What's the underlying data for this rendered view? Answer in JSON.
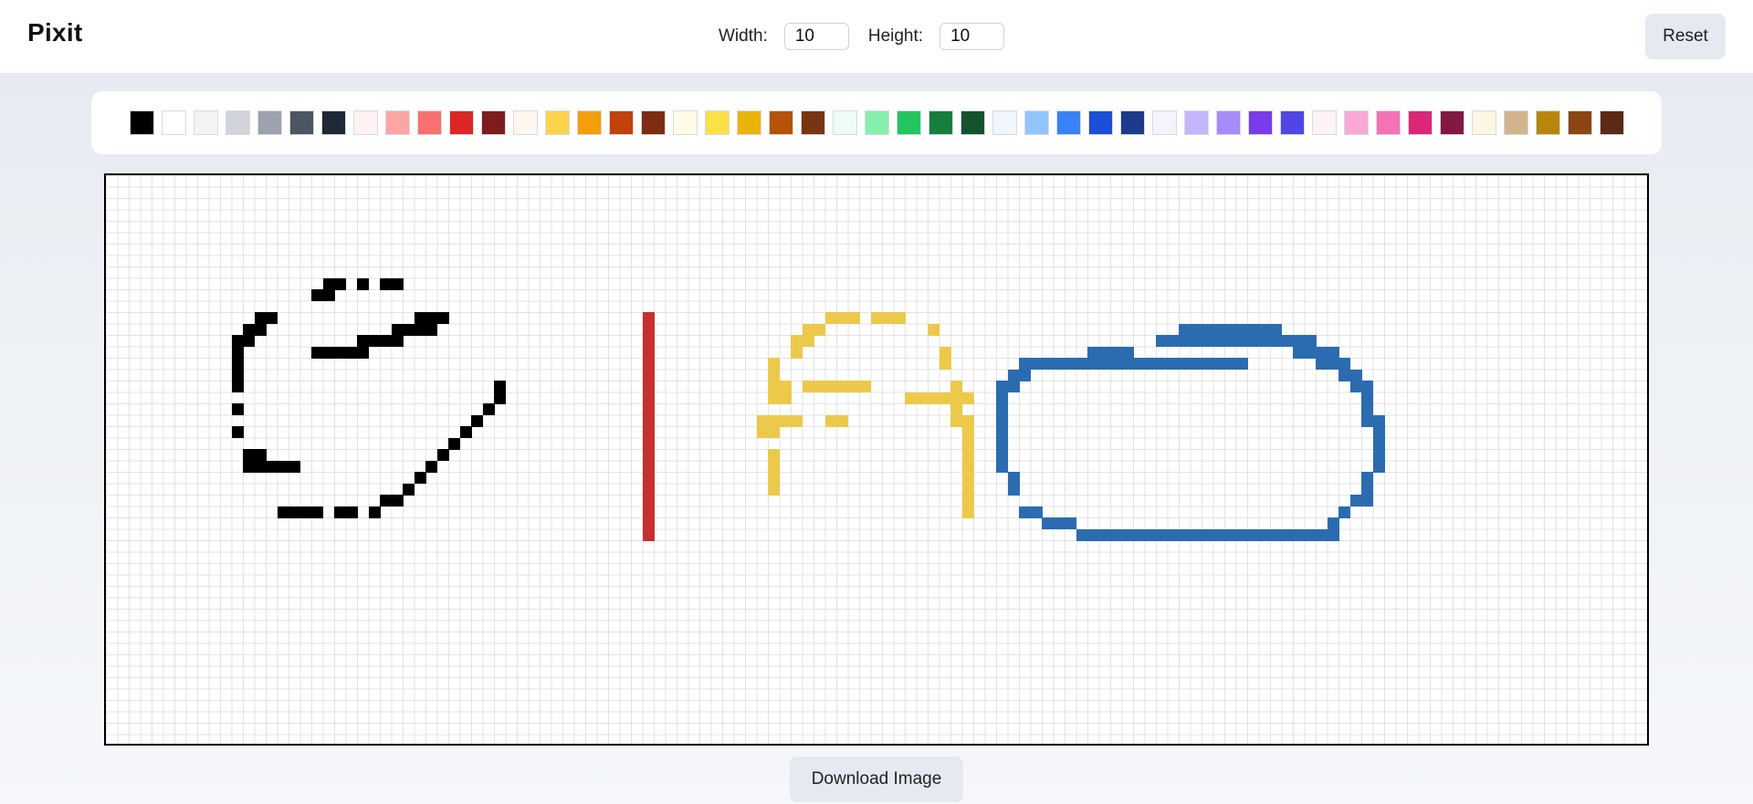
{
  "header": {
    "title": "Pixit",
    "width_label": "Width:",
    "width_value": "10",
    "height_label": "Height:",
    "height_value": "10",
    "reset_label": "Reset"
  },
  "palette": {
    "colors": [
      "#000000",
      "#ffffff",
      "#f3f4f6",
      "#d1d5db",
      "#9ca3af",
      "#4b5563",
      "#1f2937",
      "#fef2f2",
      "#fca5a5",
      "#f87171",
      "#dc2626",
      "#7f1d1d",
      "#fff7ed",
      "#fcd34d",
      "#f59e0b",
      "#c2410c",
      "#7c2d12",
      "#fefce8",
      "#fde047",
      "#eab308",
      "#b45309",
      "#78350f",
      "#ecfdf5",
      "#86efac",
      "#22c55e",
      "#15803d",
      "#14532d",
      "#eff6ff",
      "#93c5fd",
      "#3b82f6",
      "#1d4ed8",
      "#1e3a8a",
      "#f5f3ff",
      "#c4b5fd",
      "#a78bfa",
      "#7c3aed",
      "#4f46e5",
      "#fdf2f8",
      "#f9a8d4",
      "#f472b6",
      "#db2777",
      "#831843",
      "#fdf6e3",
      "#d2b48c",
      "#b8860b",
      "#8b4513",
      "#5c2a14"
    ]
  },
  "canvas": {
    "cell_colors": {
      "black": "#000000",
      "red": "#c53030",
      "yellow": "#ecc94b",
      "blue": "#2b6cb0"
    },
    "strokes": [
      {
        "color": "black",
        "cells": [
          [
            19,
            9
          ],
          [
            20,
            9
          ],
          [
            22,
            9
          ],
          [
            24,
            9
          ],
          [
            25,
            9
          ],
          [
            18,
            10
          ],
          [
            19,
            10
          ],
          [
            13,
            12
          ],
          [
            14,
            12
          ],
          [
            27,
            12
          ],
          [
            28,
            12
          ],
          [
            29,
            12
          ],
          [
            12,
            13
          ],
          [
            13,
            13
          ],
          [
            25,
            13
          ],
          [
            26,
            13
          ],
          [
            27,
            13
          ],
          [
            28,
            13
          ],
          [
            11,
            14
          ],
          [
            12,
            14
          ],
          [
            22,
            14
          ],
          [
            23,
            14
          ],
          [
            24,
            14
          ],
          [
            25,
            14
          ],
          [
            11,
            15
          ],
          [
            18,
            15
          ],
          [
            19,
            15
          ],
          [
            20,
            15
          ],
          [
            21,
            15
          ],
          [
            22,
            15
          ],
          [
            11,
            16
          ],
          [
            11,
            17
          ],
          [
            11,
            18
          ],
          [
            34,
            18
          ],
          [
            34,
            19
          ],
          [
            11,
            20
          ],
          [
            33,
            20
          ],
          [
            32,
            21
          ],
          [
            11,
            22
          ],
          [
            31,
            22
          ],
          [
            30,
            23
          ],
          [
            12,
            24
          ],
          [
            13,
            24
          ],
          [
            29,
            24
          ],
          [
            12,
            25
          ],
          [
            13,
            25
          ],
          [
            14,
            25
          ],
          [
            15,
            25
          ],
          [
            16,
            25
          ],
          [
            28,
            25
          ],
          [
            27,
            26
          ],
          [
            26,
            27
          ],
          [
            24,
            28
          ],
          [
            25,
            28
          ],
          [
            23,
            29
          ],
          [
            21,
            29
          ],
          [
            20,
            29
          ],
          [
            17,
            29
          ],
          [
            18,
            29
          ],
          [
            15,
            29
          ],
          [
            16,
            29
          ]
        ]
      },
      {
        "color": "red",
        "cells": [
          [
            47,
            12
          ],
          [
            47,
            13
          ],
          [
            47,
            14
          ],
          [
            47,
            15
          ],
          [
            47,
            16
          ],
          [
            47,
            17
          ],
          [
            47,
            18
          ],
          [
            47,
            19
          ],
          [
            47,
            20
          ],
          [
            47,
            21
          ],
          [
            47,
            22
          ],
          [
            47,
            23
          ],
          [
            47,
            24
          ],
          [
            47,
            25
          ],
          [
            47,
            26
          ],
          [
            47,
            27
          ],
          [
            47,
            28
          ],
          [
            47,
            29
          ],
          [
            47,
            30
          ],
          [
            47,
            31
          ]
        ]
      },
      {
        "color": "yellow",
        "cells": [
          [
            63,
            12
          ],
          [
            64,
            12
          ],
          [
            65,
            12
          ],
          [
            67,
            12
          ],
          [
            68,
            12
          ],
          [
            69,
            12
          ],
          [
            61,
            13
          ],
          [
            62,
            13
          ],
          [
            72,
            13
          ],
          [
            60,
            14
          ],
          [
            61,
            14
          ],
          [
            60,
            15
          ],
          [
            73,
            15
          ],
          [
            58,
            16
          ],
          [
            73,
            16
          ],
          [
            58,
            17
          ],
          [
            58,
            18
          ],
          [
            59,
            18
          ],
          [
            61,
            18
          ],
          [
            62,
            18
          ],
          [
            63,
            18
          ],
          [
            64,
            18
          ],
          [
            65,
            18
          ],
          [
            66,
            18
          ],
          [
            74,
            18
          ],
          [
            58,
            19
          ],
          [
            59,
            19
          ],
          [
            70,
            19
          ],
          [
            71,
            19
          ],
          [
            72,
            19
          ],
          [
            73,
            19
          ],
          [
            74,
            19
          ],
          [
            75,
            19
          ],
          [
            74,
            20
          ],
          [
            57,
            21
          ],
          [
            58,
            21
          ],
          [
            59,
            21
          ],
          [
            60,
            21
          ],
          [
            63,
            21
          ],
          [
            64,
            21
          ],
          [
            74,
            21
          ],
          [
            75,
            21
          ],
          [
            57,
            22
          ],
          [
            58,
            22
          ],
          [
            75,
            22
          ],
          [
            58,
            24
          ],
          [
            58,
            25
          ],
          [
            58,
            26
          ],
          [
            58,
            27
          ],
          [
            75,
            23
          ],
          [
            75,
            24
          ],
          [
            75,
            25
          ],
          [
            75,
            26
          ],
          [
            75,
            27
          ],
          [
            75,
            28
          ],
          [
            75,
            29
          ]
        ]
      },
      {
        "color": "blue",
        "cells": [
          [
            94,
            13
          ],
          [
            95,
            13
          ],
          [
            96,
            13
          ],
          [
            97,
            13
          ],
          [
            98,
            13
          ],
          [
            99,
            13
          ],
          [
            100,
            13
          ],
          [
            101,
            13
          ],
          [
            102,
            13
          ],
          [
            92,
            14
          ],
          [
            93,
            14
          ],
          [
            94,
            14
          ],
          [
            95,
            14
          ],
          [
            96,
            14
          ],
          [
            97,
            14
          ],
          [
            98,
            14
          ],
          [
            99,
            14
          ],
          [
            100,
            14
          ],
          [
            101,
            14
          ],
          [
            102,
            14
          ],
          [
            103,
            14
          ],
          [
            104,
            14
          ],
          [
            105,
            14
          ],
          [
            86,
            15
          ],
          [
            87,
            15
          ],
          [
            88,
            15
          ],
          [
            89,
            15
          ],
          [
            104,
            15
          ],
          [
            105,
            15
          ],
          [
            106,
            15
          ],
          [
            107,
            15
          ],
          [
            80,
            16
          ],
          [
            81,
            16
          ],
          [
            82,
            16
          ],
          [
            83,
            16
          ],
          [
            84,
            16
          ],
          [
            85,
            16
          ],
          [
            86,
            16
          ],
          [
            87,
            16
          ],
          [
            88,
            16
          ],
          [
            89,
            16
          ],
          [
            90,
            16
          ],
          [
            91,
            16
          ],
          [
            92,
            16
          ],
          [
            93,
            16
          ],
          [
            94,
            16
          ],
          [
            95,
            16
          ],
          [
            96,
            16
          ],
          [
            97,
            16
          ],
          [
            98,
            16
          ],
          [
            99,
            16
          ],
          [
            106,
            16
          ],
          [
            107,
            16
          ],
          [
            108,
            16
          ],
          [
            79,
            17
          ],
          [
            80,
            17
          ],
          [
            108,
            17
          ],
          [
            109,
            17
          ],
          [
            78,
            18
          ],
          [
            79,
            18
          ],
          [
            109,
            18
          ],
          [
            110,
            18
          ],
          [
            78,
            19
          ],
          [
            110,
            19
          ],
          [
            78,
            20
          ],
          [
            110,
            20
          ],
          [
            78,
            21
          ],
          [
            110,
            21
          ],
          [
            111,
            21
          ],
          [
            78,
            22
          ],
          [
            111,
            22
          ],
          [
            78,
            23
          ],
          [
            111,
            23
          ],
          [
            78,
            24
          ],
          [
            111,
            24
          ],
          [
            78,
            25
          ],
          [
            111,
            25
          ],
          [
            79,
            26
          ],
          [
            110,
            26
          ],
          [
            79,
            27
          ],
          [
            110,
            27
          ],
          [
            110,
            28
          ],
          [
            109,
            28
          ],
          [
            80,
            29
          ],
          [
            81,
            29
          ],
          [
            108,
            29
          ],
          [
            82,
            30
          ],
          [
            83,
            30
          ],
          [
            84,
            30
          ],
          [
            107,
            30
          ],
          [
            85,
            31
          ],
          [
            86,
            31
          ],
          [
            87,
            31
          ],
          [
            88,
            31
          ],
          [
            89,
            31
          ],
          [
            90,
            31
          ],
          [
            91,
            31
          ],
          [
            92,
            31
          ],
          [
            93,
            31
          ],
          [
            94,
            31
          ],
          [
            95,
            31
          ],
          [
            96,
            31
          ],
          [
            97,
            31
          ],
          [
            98,
            31
          ],
          [
            99,
            31
          ],
          [
            100,
            31
          ],
          [
            101,
            31
          ],
          [
            102,
            31
          ],
          [
            103,
            31
          ],
          [
            104,
            31
          ],
          [
            105,
            31
          ],
          [
            106,
            31
          ],
          [
            107,
            31
          ]
        ]
      }
    ]
  },
  "footer": {
    "download_label": "Download Image"
  }
}
